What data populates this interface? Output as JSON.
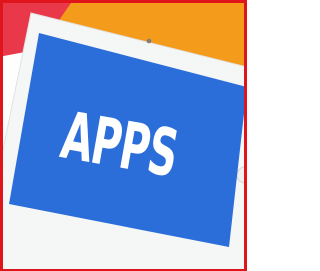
{
  "illustration": {
    "screen_text": "APPS",
    "colors": {
      "border": "#e0141b",
      "back_card_orange": "#f49b1c",
      "back_card_red": "#e8384a",
      "tablet_body": "#f5f6f6",
      "tablet_shadow": "#c9c9c9",
      "screen": "#2b6ed9",
      "screen_text": "#ffffff",
      "camera": "#7d7d7d"
    }
  }
}
